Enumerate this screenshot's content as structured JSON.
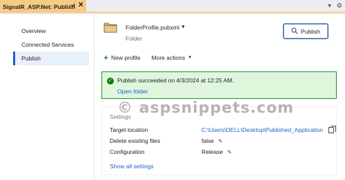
{
  "tab": {
    "title": "SignalR_ASP.Net: Publish",
    "pin_glyph": "⊣",
    "close_glyph": "✕"
  },
  "strip_right": {
    "dropdown_glyph": "▾",
    "gear_glyph": "⚙"
  },
  "sidebar": {
    "items": [
      {
        "label": "Overview",
        "active": false
      },
      {
        "label": "Connected Services",
        "active": false
      },
      {
        "label": "Publish",
        "active": true
      }
    ]
  },
  "profile": {
    "name": "FolderProfile.pubxml",
    "type": "Folder"
  },
  "publish_button": {
    "label": "Publish"
  },
  "actions": {
    "new_profile": "New profile",
    "more_actions": "More actions"
  },
  "status": {
    "message": "Publish succeeded on 4/3/2024 at 12:25 AM.",
    "open_folder": "Open folder",
    "color": "#107c10"
  },
  "watermark": "© aspsnippets.com",
  "settings": {
    "title": "Settings",
    "rows": [
      {
        "label": "Target location",
        "value": "C:\\Users\\DELL\\Desktop\\Published_Application"
      },
      {
        "label": "Delete existing files",
        "value": "false"
      },
      {
        "label": "Configuration",
        "value": "Release"
      }
    ],
    "show_all": "Show all settings"
  },
  "colors": {
    "accent": "#1a64c8",
    "tab": "#f5cc84",
    "success_bg": "#dff6dd"
  }
}
